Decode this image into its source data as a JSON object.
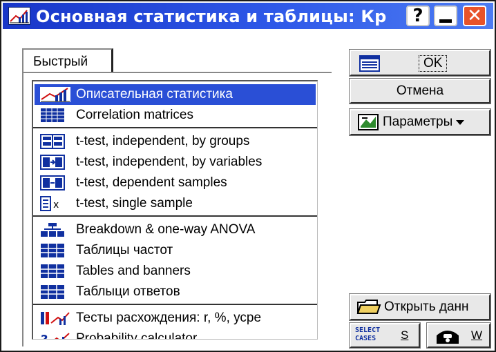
{
  "window": {
    "title": "Основная статистика и таблицы: Кр",
    "help_glyph": "?",
    "close_glyph": "✕"
  },
  "tabs": [
    {
      "label": "Быстрый"
    }
  ],
  "list": {
    "groups": [
      {
        "items": [
          {
            "label": "Описательная статистика",
            "icon": "descriptive-chart-icon",
            "selected": true
          },
          {
            "label": "Correlation matrices",
            "icon": "matrix-icon"
          }
        ]
      },
      {
        "items": [
          {
            "label": "t-test, independent, by groups",
            "icon": "ttest-groups-icon"
          },
          {
            "label": "t-test, independent, by variables",
            "icon": "ttest-variables-icon"
          },
          {
            "label": "t-test, dependent samples",
            "icon": "ttest-dependent-icon"
          },
          {
            "label": "t-test, single sample",
            "icon": "ttest-single-icon"
          }
        ]
      },
      {
        "items": [
          {
            "label": "Breakdown & one-way ANOVA",
            "icon": "breakdown-icon"
          },
          {
            "label": "Таблицы частот",
            "icon": "table-icon"
          },
          {
            "label": "Tables and banners",
            "icon": "table-icon"
          },
          {
            "label": "Таблыци ответов",
            "icon": "table-icon"
          }
        ]
      },
      {
        "items": [
          {
            "label": "Тесты расхождения: r, %, усре",
            "icon": "difference-tests-icon"
          },
          {
            "label": "Probability calculator",
            "icon": "probability-icon"
          }
        ]
      }
    ]
  },
  "buttons": {
    "ok": "OK",
    "cancel": "Отмена",
    "params": "Параметры",
    "open": "Открыть данн",
    "select_cases_line1": "SELECT",
    "select_cases_line2": "CASES",
    "select_hotkey": "S",
    "weight_hotkey": "W"
  },
  "colors": {
    "title_bar": "#2445d8",
    "selection": "#2a4fd6",
    "close_button": "#e8532a"
  }
}
